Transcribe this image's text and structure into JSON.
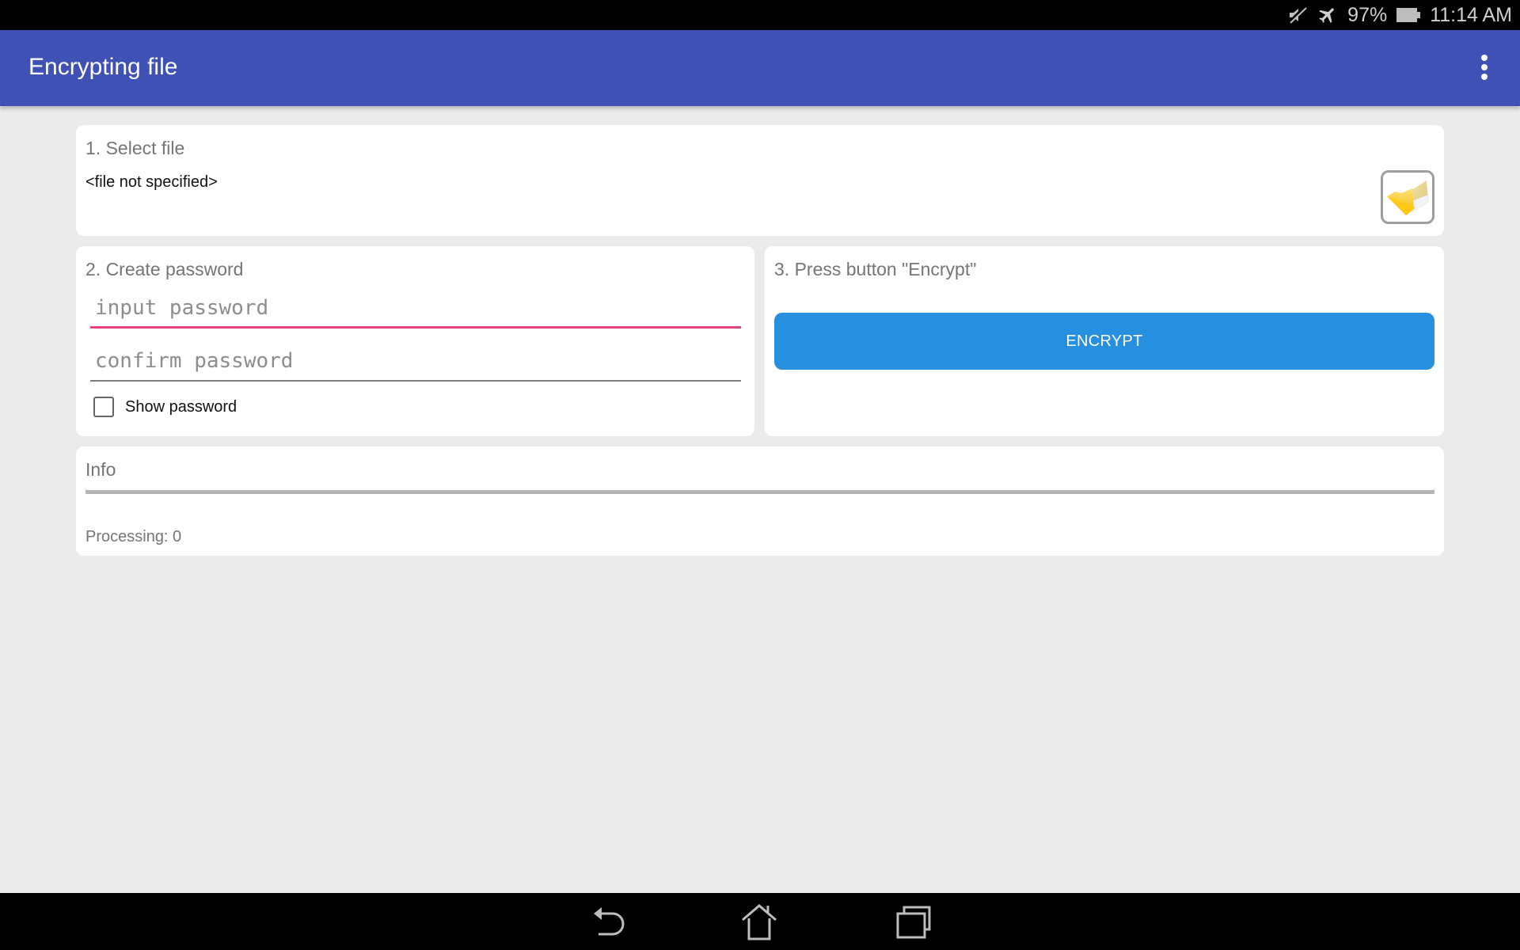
{
  "status_bar": {
    "icons": [
      "muted-icon",
      "airplane-mode-icon",
      "battery-icon"
    ],
    "battery_percent": "97%",
    "time": "11:14 AM"
  },
  "app_bar": {
    "title": "Encrypting file",
    "menu_icon": "overflow-menu-icon"
  },
  "select_file": {
    "title": "1. Select file",
    "file_value": "<file not specified>",
    "browse_icon": "folder-icon"
  },
  "create_password": {
    "title": "2. Create password",
    "password_placeholder": "input password",
    "password_value": "",
    "confirm_placeholder": "confirm password",
    "confirm_value": "",
    "show_password_label": "Show password",
    "show_password_checked": false
  },
  "encrypt": {
    "title": "3. Press button \"Encrypt\"",
    "button_label": "ENCRYPT",
    "button_color": "#268fdf"
  },
  "info": {
    "title": "Info",
    "progress_percent": 0,
    "processing_text": "Processing: 0"
  },
  "nav_bar": {
    "buttons": [
      "back-icon",
      "home-icon",
      "recent-apps-icon"
    ]
  },
  "colors": {
    "app_bar": "#3f51b5",
    "accent": "#e84478",
    "background": "#ebebeb"
  }
}
